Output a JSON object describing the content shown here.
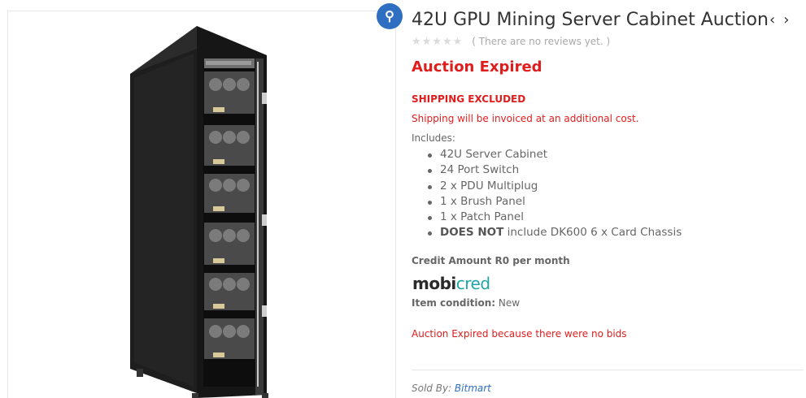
{
  "product": {
    "title": "42U GPU Mining Server Cabinet Auction",
    "image_alt": "42U server cabinet with GPU mining rigs",
    "zoom_icon": "zoom-icon"
  },
  "navigation": {
    "prev_label": "‹",
    "next_label": "›"
  },
  "rating": {
    "stars_filled": 0,
    "stars_total": 5,
    "review_note": "( There are no reviews yet. )"
  },
  "auction": {
    "status": "Auction Expired",
    "reason": "Auction Expired because there were no bids"
  },
  "shipping": {
    "heading": "SHIPPING EXCLUDED",
    "note": "Shipping will be invoiced at an additional cost."
  },
  "includes": {
    "label": "Includes:",
    "items": [
      "42U Server Cabinet",
      "24 Port Switch",
      "2 x PDU Multiplug",
      "1 x Brush Panel",
      "1 x Patch Panel"
    ],
    "exclusion": {
      "bold": "DOES NOT",
      "rest": " include DK600 6 x Card Chassis"
    }
  },
  "credit": {
    "text": "Credit Amount R0 per month",
    "logo_dark": "mobi",
    "logo_teal": "cred"
  },
  "condition": {
    "label": "Item condition:",
    "value": " New"
  },
  "seller": {
    "prefix": "Sold By: ",
    "name": "Bitmart"
  },
  "colors": {
    "accent_red": "#e01d1d",
    "link_blue": "#2f6fc1",
    "brand_teal": "#1fa5a5"
  }
}
